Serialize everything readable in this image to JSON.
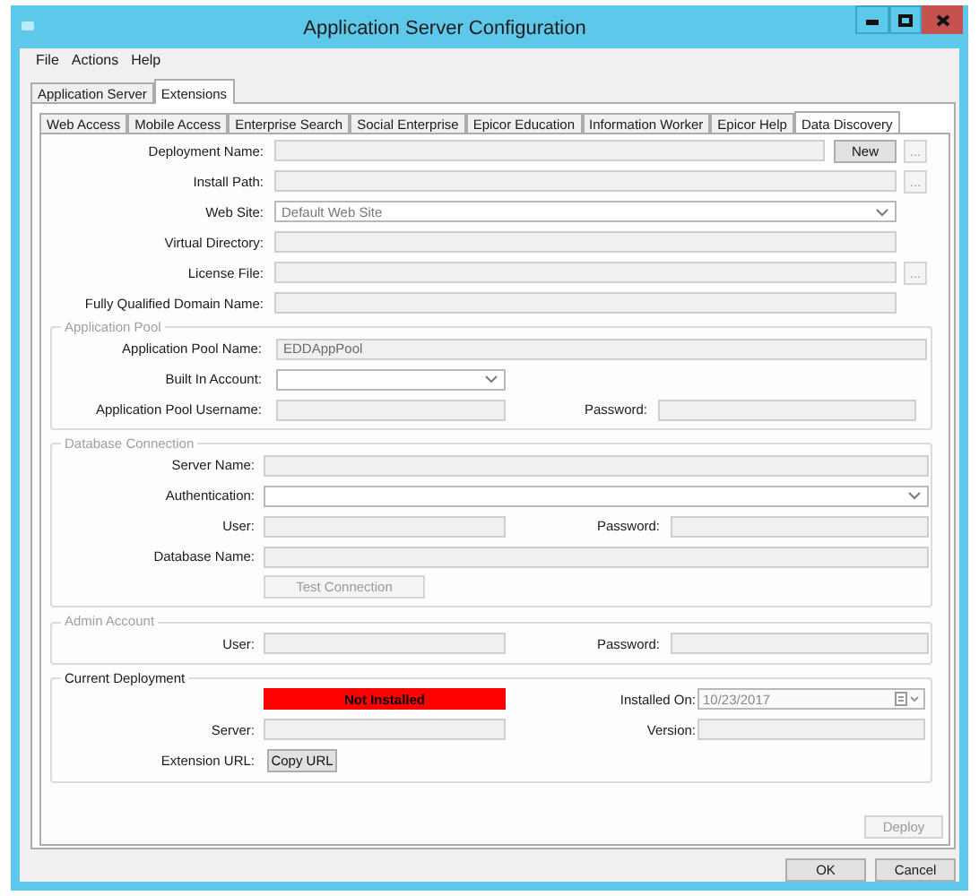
{
  "window": {
    "title": "Application Server Configuration"
  },
  "menu": [
    {
      "label": "File"
    },
    {
      "label": "Actions"
    },
    {
      "label": "Help"
    }
  ],
  "outer_tabs": [
    {
      "label": "Application Server",
      "selected": false
    },
    {
      "label": "Extensions",
      "selected": true
    }
  ],
  "inner_tabs": [
    {
      "label": "Web Access",
      "selected": false
    },
    {
      "label": "Mobile Access",
      "selected": false
    },
    {
      "label": "Enterprise Search",
      "selected": false
    },
    {
      "label": "Social Enterprise",
      "selected": false
    },
    {
      "label": "Epicor Education",
      "selected": false
    },
    {
      "label": "Information Worker",
      "selected": false
    },
    {
      "label": "Epicor Help",
      "selected": false
    },
    {
      "label": "Data Discovery",
      "selected": true
    }
  ],
  "deployment": [
    {
      "label": "Deployment Name:",
      "kind": "text",
      "buttons": [
        {
          "label": "New",
          "disabled": false
        },
        {
          "label": "...",
          "disabled": true
        }
      ]
    },
    {
      "label": "Install Path:",
      "kind": "text",
      "buttons": [
        {
          "label": "...",
          "disabled": true
        }
      ]
    },
    {
      "label": "Web Site:",
      "kind": "combo",
      "value": "Default Web Site"
    },
    {
      "label": "Virtual Directory:",
      "kind": "text"
    },
    {
      "label": "License File:",
      "kind": "text",
      "buttons": [
        {
          "label": "...",
          "disabled": true
        }
      ]
    },
    {
      "label": "Fully Qualified Domain Name:",
      "kind": "text"
    }
  ],
  "application_pool": {
    "title": "Application Pool",
    "disabled": true,
    "pool_name": {
      "label": "Application Pool Name:",
      "kind": "text",
      "value": "EDDAppPool"
    },
    "built_in_account": {
      "label": "Built In Account:",
      "kind": "combo"
    },
    "username": {
      "label": "Application Pool Username:",
      "kind": "text"
    },
    "password": {
      "label": "Password:",
      "kind": "text"
    }
  },
  "database_connection": {
    "title": "Database Connection",
    "disabled": true,
    "server_name": {
      "label": "Server Name:",
      "kind": "text"
    },
    "authentication": {
      "label": "Authentication:",
      "kind": "combo"
    },
    "user": {
      "label": "User:",
      "kind": "text"
    },
    "password": {
      "label": "Password:",
      "kind": "text"
    },
    "database_name": {
      "label": "Database Name:",
      "kind": "text"
    },
    "test_button": {
      "label": "Test Connection",
      "disabled": true
    }
  },
  "admin_account": {
    "title": "Admin Account",
    "disabled": true,
    "user": {
      "label": "User:",
      "kind": "text"
    },
    "password": {
      "label": "Password:",
      "kind": "text"
    }
  },
  "current_deployment": {
    "title": "Current Deployment",
    "disabled": false,
    "status": {
      "text": "Not Installed",
      "installed": false
    },
    "installed_on": {
      "label": "Installed On:",
      "kind": "date",
      "value": "10/23/2017"
    },
    "server": {
      "label": "Server:",
      "kind": "text"
    },
    "version": {
      "label": "Version:",
      "kind": "text"
    },
    "extension_url": {
      "label": "Extension URL:",
      "button": {
        "label": "Copy URL",
        "disabled": false
      }
    }
  },
  "deploy_button": {
    "label": "Deploy",
    "disabled": true
  },
  "buttons": [
    {
      "label": "OK"
    },
    {
      "label": "Cancel"
    }
  ]
}
